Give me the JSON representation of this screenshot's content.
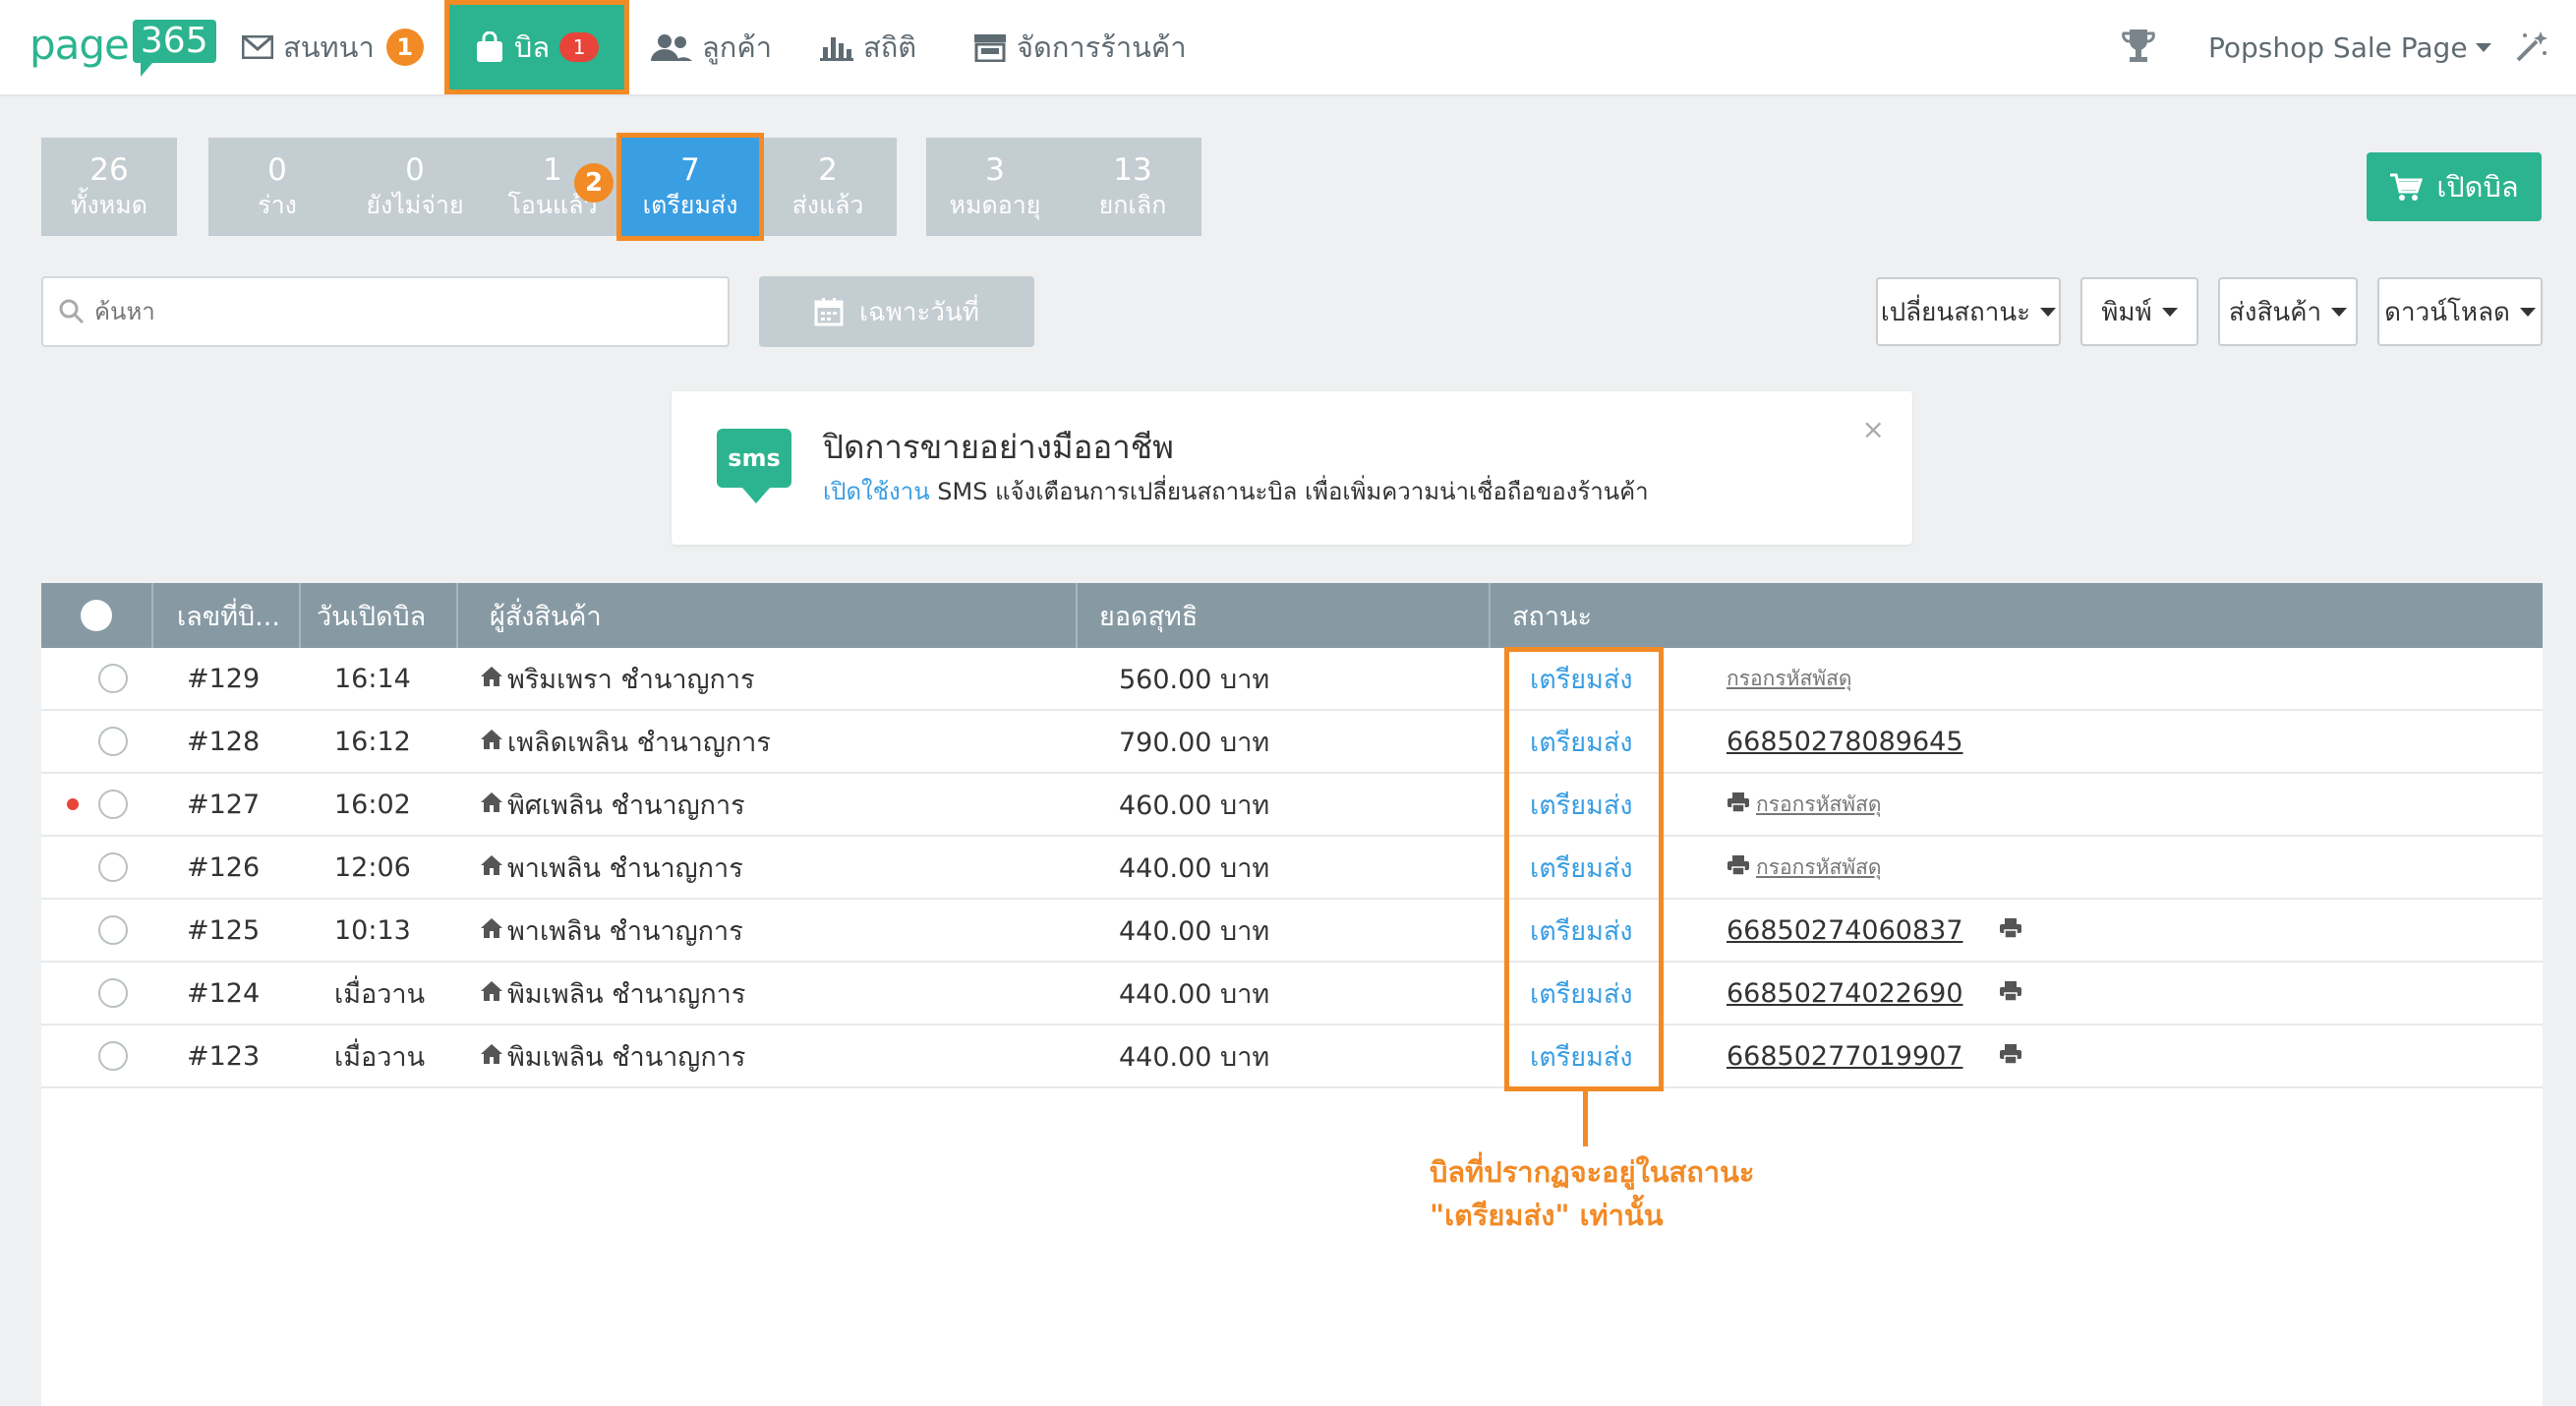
{
  "brand": {
    "logo_text": "page",
    "logo_box": "365"
  },
  "colors": {
    "accent": "#2bb48f",
    "active_tab": "#3a9ee3",
    "highlight": "#f28a25",
    "badge": "#e8443a",
    "header": "#879aa4"
  },
  "nav": {
    "chat_label": "สนทนา",
    "chat_badge": "1",
    "bill_label": "บิล",
    "bill_badge": "1",
    "customer_label": "ลูกค้า",
    "stats_label": "สถิติ",
    "shop_label": "จัดการร้านค้า",
    "page_label": "Popshop Sale Page"
  },
  "tabs": [
    {
      "count": "26",
      "label": "ทั้งหมด"
    },
    {
      "count": "0",
      "label": "ร่าง"
    },
    {
      "count": "0",
      "label": "ยังไม่จ่าย"
    },
    {
      "count": "1",
      "label": "โอนแล้ว"
    },
    {
      "count": "7",
      "label": "เตรียมส่ง"
    },
    {
      "count": "2",
      "label": "ส่งแล้ว"
    },
    {
      "count": "3",
      "label": "หมดอายุ"
    },
    {
      "count": "13",
      "label": "ยกเลิก"
    }
  ],
  "step_badge": "2",
  "open_bill_label": "เปิดบิล",
  "search": {
    "placeholder": "ค้นหา"
  },
  "date_filter_label": "เฉพาะวันที่",
  "dropdowns": {
    "change_status": "เปลี่ยนสถานะ",
    "print": "พิมพ์",
    "ship": "ส่งสินค้า",
    "download": "ดาวน์โหลด"
  },
  "banner": {
    "icon_text": "sms",
    "title": "ปิดการขายอย่างมืออาชีพ",
    "link": "เปิดใช้งาน",
    "text": " SMS แจ้งเตือนการเปลี่ยนสถานะบิล เพื่อเพิ่มความน่าเชื่อถือของร้านค้า",
    "close": "×"
  },
  "table": {
    "headers": {
      "no": "เลขที่บิ...",
      "date": "วันเปิดบิล",
      "customer": "ผู้สั่งสินค้า",
      "total": "ยอดสุทธิ",
      "status": "สถานะ"
    },
    "rows": [
      {
        "no": "#129",
        "date": "16:14",
        "customer": "พริมเพรา ชำนาญการ",
        "total": "560.00 บาท",
        "status": "เตรียมส่ง",
        "tracking": "กรอกรหัสพัสดุ",
        "tracking_is_link": true,
        "print_before": false,
        "print_after": false,
        "dot": false
      },
      {
        "no": "#128",
        "date": "16:12",
        "customer": "เพลิดเพลิน ชำนาญการ",
        "total": "790.00 บาท",
        "status": "เตรียมส่ง",
        "tracking": "66850278089645",
        "tracking_is_link": false,
        "print_before": false,
        "print_after": false,
        "dot": false
      },
      {
        "no": "#127",
        "date": "16:02",
        "customer": "พิศเพลิน ชำนาญการ",
        "total": "460.00 บาท",
        "status": "เตรียมส่ง",
        "tracking": "กรอกรหัสพัสดุ",
        "tracking_is_link": true,
        "print_before": true,
        "print_after": false,
        "dot": true
      },
      {
        "no": "#126",
        "date": "12:06",
        "customer": "พาเพลิน ชำนาญการ",
        "total": "440.00 บาท",
        "status": "เตรียมส่ง",
        "tracking": "กรอกรหัสพัสดุ",
        "tracking_is_link": true,
        "print_before": true,
        "print_after": false,
        "dot": false
      },
      {
        "no": "#125",
        "date": "10:13",
        "customer": "พาเพลิน ชำนาญการ",
        "total": "440.00 บาท",
        "status": "เตรียมส่ง",
        "tracking": "66850274060837",
        "tracking_is_link": false,
        "print_before": false,
        "print_after": true,
        "dot": false
      },
      {
        "no": "#124",
        "date": "เมื่อวาน",
        "customer": "พิมเพลิน ชำนาญการ",
        "total": "440.00 บาท",
        "status": "เตรียมส่ง",
        "tracking": "66850274022690",
        "tracking_is_link": false,
        "print_before": false,
        "print_after": true,
        "dot": false
      },
      {
        "no": "#123",
        "date": "เมื่อวาน",
        "customer": "พิมเพลิน ชำนาญการ",
        "total": "440.00 บาท",
        "status": "เตรียมส่ง",
        "tracking": "66850277019907",
        "tracking_is_link": false,
        "print_before": false,
        "print_after": true,
        "dot": false
      }
    ]
  },
  "callout": {
    "line1": "บิลที่ปรากฏจะอยู่ในสถานะ",
    "line2": "\"เตรียมส่ง\" เท่านั้น"
  }
}
